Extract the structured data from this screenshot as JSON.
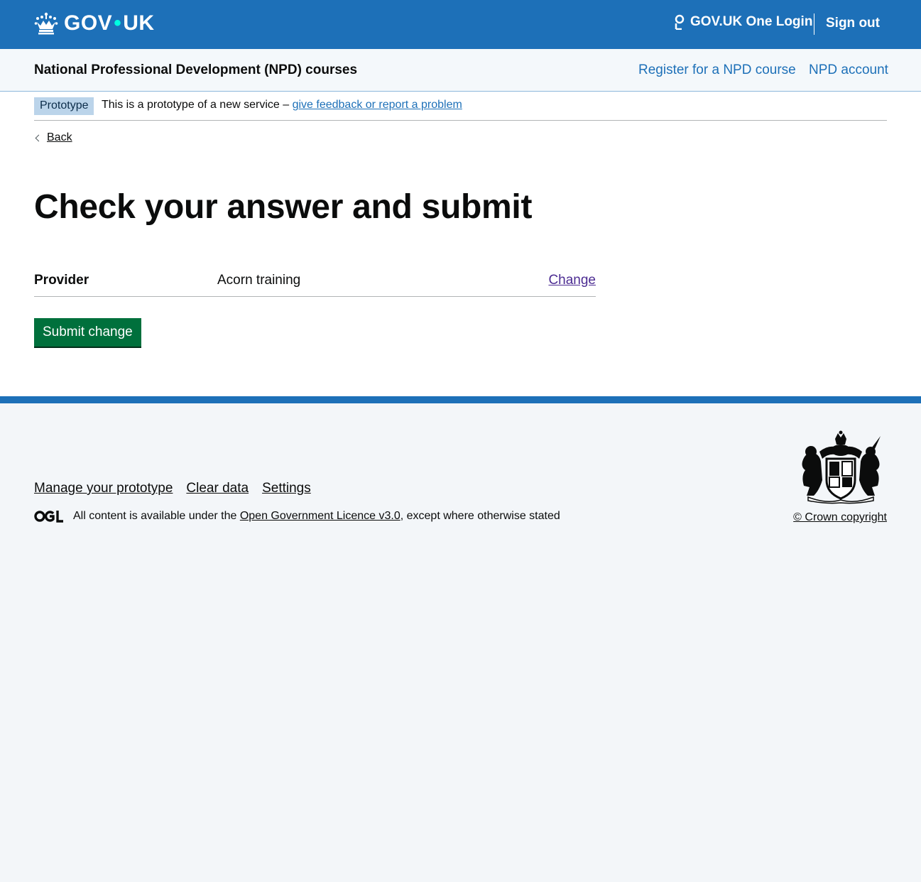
{
  "header": {
    "logo_text_left": "GOV",
    "logo_dot": "•",
    "logo_text_right": "UK",
    "one_login": "GOV.UK One Login",
    "sign_out": "Sign out"
  },
  "service": {
    "name": "National Professional Development (NPD) courses",
    "nav": [
      {
        "label": "Register for a NPD course"
      },
      {
        "label": "NPD account"
      }
    ]
  },
  "phase_banner": {
    "tag": "Prototype",
    "text": "This is a prototype of a new service –",
    "link": "give feedback or report a problem"
  },
  "back_link": "Back",
  "page_title": "Check your answer and submit",
  "summary": {
    "key": "Provider",
    "value": "Acorn training",
    "action": "Change"
  },
  "submit_button": "Submit change",
  "footer": {
    "links": [
      {
        "label": "Manage your prototype"
      },
      {
        "label": "Clear data"
      },
      {
        "label": "Settings"
      }
    ],
    "licence_prefix": "All content is available under the",
    "licence_link": "Open Government Licence v3.0",
    "licence_suffix": ", except where otherwise stated",
    "crown_copyright": "© Crown copyright"
  },
  "colors": {
    "brand_blue": "#1d70b8",
    "button_green": "#00703c",
    "visited_link": "#4c2c92"
  },
  "icons": [
    "crown-icon",
    "person-icon",
    "chevron-left-icon",
    "ogl-logo-icon",
    "royal-crest-icon"
  ]
}
